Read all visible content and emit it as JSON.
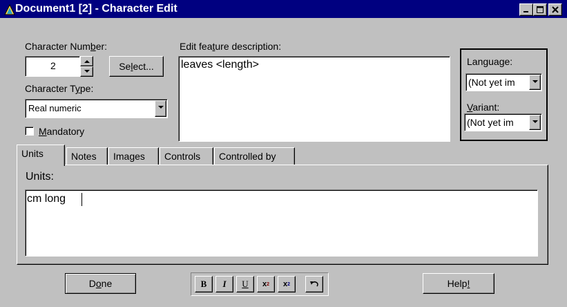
{
  "window": {
    "title": "Document1 [2] - Character Edit",
    "titlebar_color": "#000080",
    "face_color": "#c0c0c0",
    "controls": [
      "minimize-icon",
      "maximize-icon",
      "close-icon"
    ]
  },
  "character_number": {
    "label_pre": "Character Num",
    "label_key": "b",
    "label_post": "er:",
    "value": "2",
    "select_pre": "Se",
    "select_key": "l",
    "select_post": "ect..."
  },
  "character_type": {
    "label_pre": "Character T",
    "label_key": "y",
    "label_post": "pe:",
    "value": "Real numeric"
  },
  "mandatory": {
    "label_key": "M",
    "label_post": "andatory",
    "checked": false
  },
  "description": {
    "label_pre": "Edit fea",
    "label_key": "t",
    "label_post": "ure description:",
    "value": "leaves <length>"
  },
  "language": {
    "label": "Language:",
    "value": "(Not yet im",
    "variant_label_key": "V",
    "variant_label_post": "ariant:",
    "variant_value": "(Not yet im"
  },
  "tabs": [
    {
      "label": "Units",
      "active": true
    },
    {
      "label": "Notes",
      "active": false
    },
    {
      "label": "Images",
      "active": false
    },
    {
      "label": "Controls",
      "active": false
    },
    {
      "label": "Controlled by",
      "active": false
    }
  ],
  "units": {
    "label": "Units:",
    "value": "cm long"
  },
  "buttons": {
    "done_pre": "D",
    "done_key": "o",
    "done_post": "ne",
    "help_pre": "Help",
    "help_key": "!",
    "help_post": ""
  },
  "format_toolbar": {
    "bold": "B",
    "italic": "I",
    "underline": "U",
    "superscript_base": "x",
    "superscript_mark": "2",
    "subscript_base": "x",
    "subscript_mark": "2",
    "undo_icon": "undo-icon"
  }
}
